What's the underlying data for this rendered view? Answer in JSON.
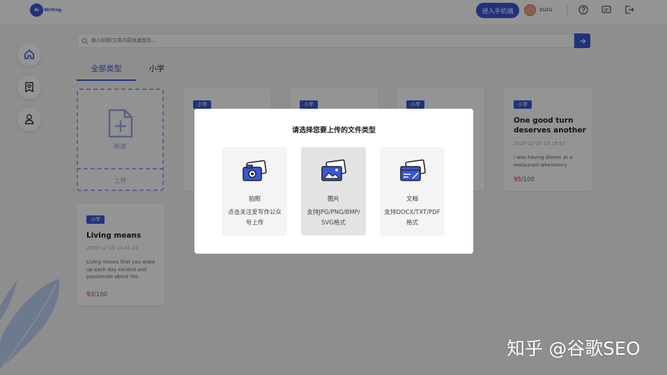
{
  "header": {
    "logo_mark": "Ai",
    "logo_text": "Writing",
    "mobile_button": "进入手机端",
    "username": "zuzu"
  },
  "search": {
    "placeholder": "输入标题/文章内容快速查找..."
  },
  "tabs": [
    {
      "label": "全部类型",
      "active": true
    },
    {
      "label": "小学",
      "active": false
    }
  ],
  "new_card": {
    "new_label": "新建",
    "upload_label": "上传"
  },
  "cards": [
    {
      "badge": "小学",
      "title": "One good turn deserves another",
      "date": "2020-12-10   13:19:57",
      "excerpt": "I was having dinner at a restaurant whenHarry",
      "score": "95",
      "total": "/100"
    },
    {
      "badge": "小学",
      "title": "Living means",
      "date": "2020-12-10   14:34:22",
      "excerpt": "Living means that you wake up each day excited and passionate about the",
      "score": "93",
      "total": "/100"
    },
    {
      "badge": "小学"
    },
    {
      "badge": "小学"
    },
    {
      "badge": "小学"
    }
  ],
  "modal": {
    "title": "请选择您要上传的文件类型",
    "options": [
      {
        "label": "拍照",
        "desc": "点击关注爱写作公众号上传",
        "icon": "camera-icon",
        "selected": false
      },
      {
        "label": "图片",
        "desc": "支持JPG/PNG/BMP/SVG格式",
        "icon": "image-icon",
        "selected": true
      },
      {
        "label": "文档",
        "desc": "支持DOCX/TXT/PDF格式",
        "icon": "document-icon",
        "selected": false
      }
    ]
  },
  "watermark": "知乎 @谷歌SEO",
  "colors": {
    "accent": "#3a57d6",
    "score": "#d62c2c"
  }
}
